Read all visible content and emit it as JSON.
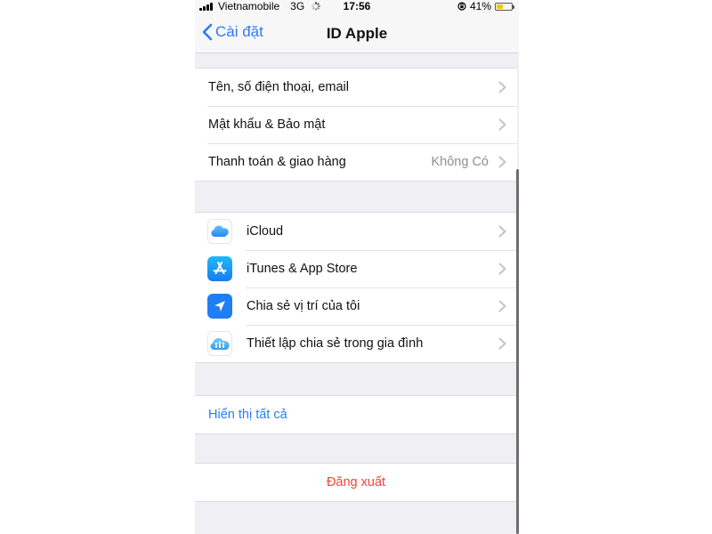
{
  "status_bar": {
    "carrier": "Vietnamobile",
    "network": "3G",
    "time": "17:56",
    "battery_percent": "41%",
    "battery_level": 0.41,
    "battery_color": "#f5c400"
  },
  "nav": {
    "back_label": "Cài đặt",
    "title": "ID Apple"
  },
  "group1": [
    {
      "label": "Tên, số điện thoại, email",
      "value": ""
    },
    {
      "label": "Mật khẩu & Bảo mật",
      "value": ""
    },
    {
      "label": "Thanh toán & giao hàng",
      "value": "Không Có"
    }
  ],
  "group2": [
    {
      "label": "iCloud",
      "icon": "icloud-icon"
    },
    {
      "label": "iTunes & App Store",
      "icon": "app-store-icon"
    },
    {
      "label": "Chia sẻ vị trí của tôi",
      "icon": "location-arrow-icon"
    },
    {
      "label": "Thiết lập chia sẻ trong gia đình",
      "icon": "family-sharing-icon"
    }
  ],
  "show_all_label": "Hiển thị tất cả",
  "sign_out_label": "Đăng xuất",
  "colors": {
    "accent": "#2b7bf6",
    "destructive": "#f04438",
    "background": "#efeff4"
  }
}
